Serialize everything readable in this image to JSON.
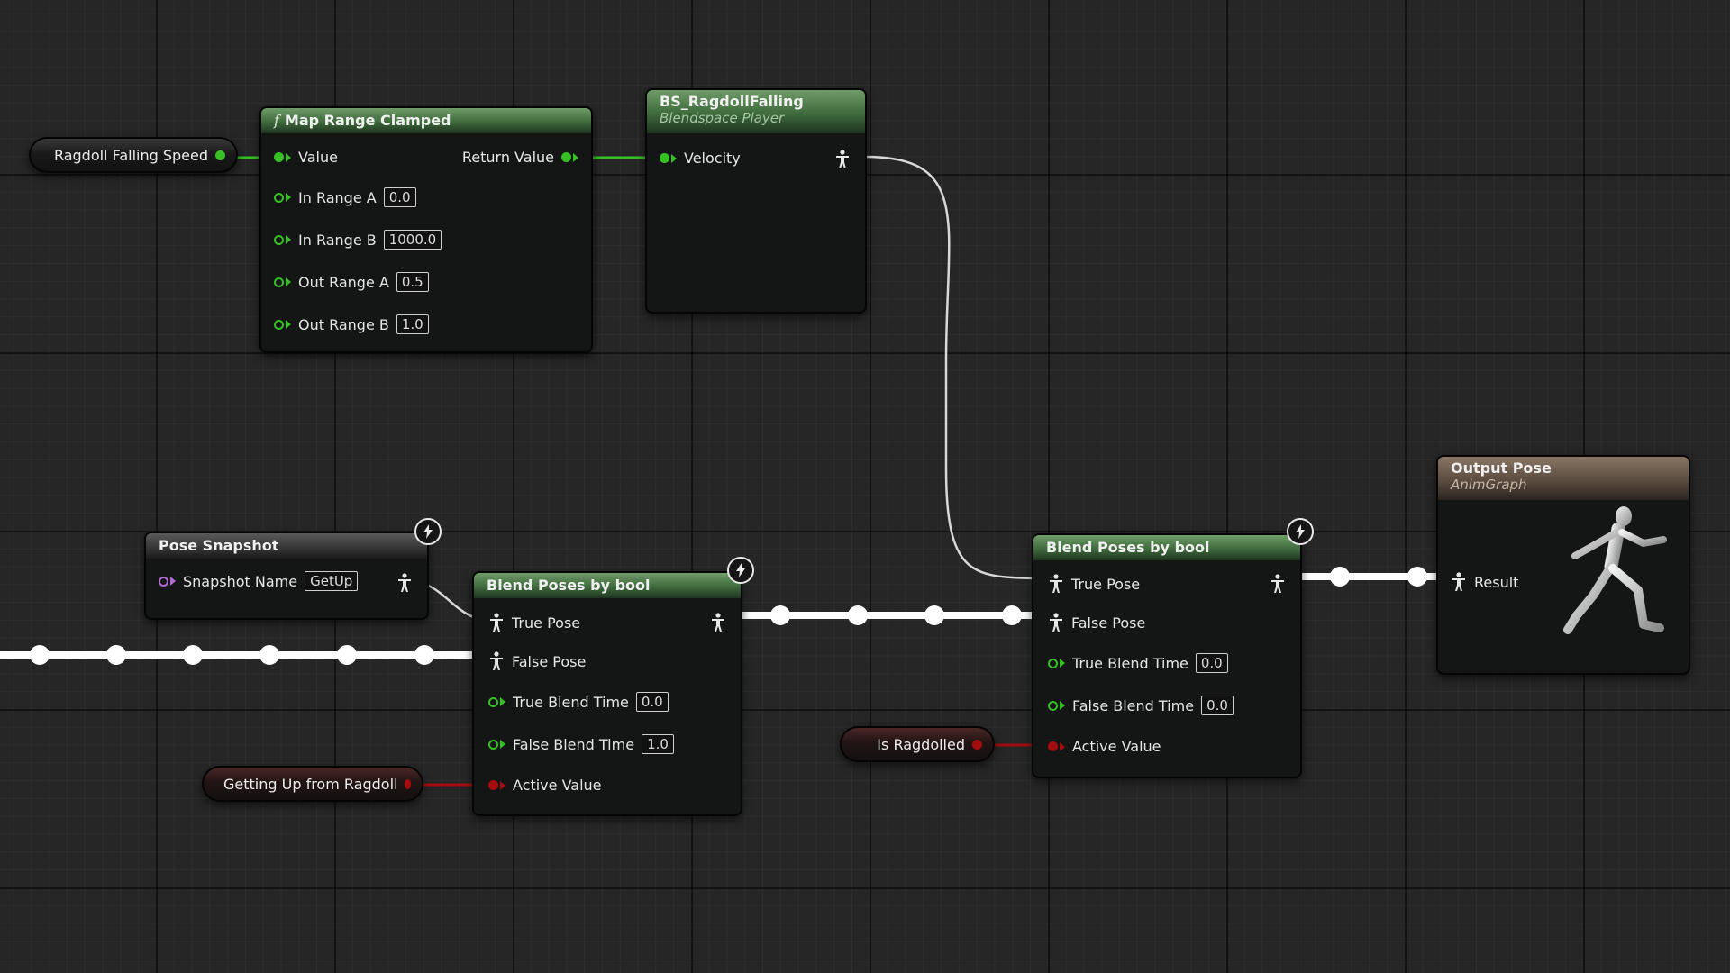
{
  "canvas": {
    "background": "#262626",
    "exec_wire_color": "#ffffff",
    "float_wire_color": "#36c024",
    "bool_wire_color": "#a40d0d",
    "pose_wire_color": "#d8d8d8"
  },
  "variables": {
    "ragdoll_falling_speed": "Ragdoll Falling Speed",
    "getting_up_from_ragdoll": "Getting Up from Ragdoll",
    "is_ragdolled": "Is Ragdolled"
  },
  "map_range_node": {
    "title": "Map Range Clamped",
    "icon": "function-icon",
    "pins": {
      "value": "Value",
      "return_value": "Return Value",
      "in_range_a_label": "In Range A",
      "in_range_a_value": "0.0",
      "in_range_b_label": "In Range B",
      "in_range_b_value": "1000.0",
      "out_range_a_label": "Out Range A",
      "out_range_a_value": "0.5",
      "out_range_b_label": "Out Range B",
      "out_range_b_value": "1.0"
    }
  },
  "blendspace_node": {
    "title": "BS_RagdollFalling",
    "subtitle": "Blendspace Player",
    "pins": {
      "velocity": "Velocity"
    }
  },
  "pose_snapshot_node": {
    "title": "Pose Snapshot",
    "pins": {
      "snapshot_name_label": "Snapshot Name",
      "snapshot_name_value": "GetUp"
    }
  },
  "blend_bool_left": {
    "title": "Blend Poses by bool",
    "pins": {
      "true_pose": "True Pose",
      "false_pose": "False Pose",
      "true_blend_time_label": "True Blend Time",
      "true_blend_time_value": "0.0",
      "false_blend_time_label": "False Blend Time",
      "false_blend_time_value": "1.0",
      "active_value": "Active Value"
    }
  },
  "blend_bool_right": {
    "title": "Blend Poses by bool",
    "pins": {
      "true_pose": "True Pose",
      "false_pose": "False Pose",
      "true_blend_time_label": "True Blend Time",
      "true_blend_time_value": "0.0",
      "false_blend_time_label": "False Blend Time",
      "false_blend_time_value": "0.0",
      "active_value": "Active Value"
    }
  },
  "output_pose_node": {
    "title": "Output Pose",
    "subtitle": "AnimGraph",
    "pins": {
      "result": "Result"
    },
    "icon": "running-mannequin-icon"
  }
}
